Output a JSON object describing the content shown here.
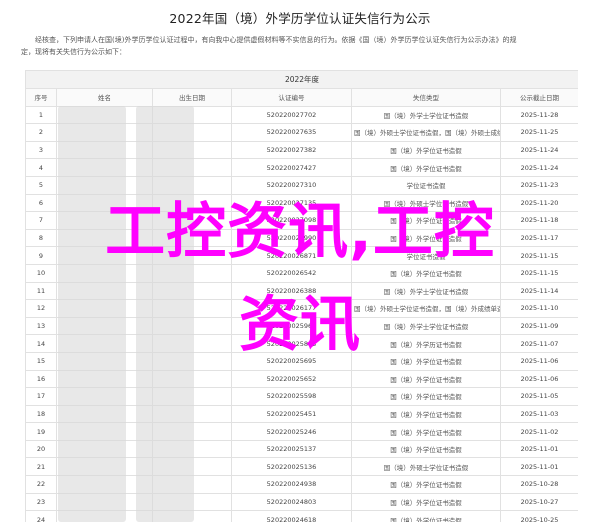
{
  "page_title": "2022年国（境）外学历学位认证失信行为公示",
  "intro_lines": [
    "经核查，下列申请人在国(境)外学历学位认证过程中，有向我中心提供虚假材料等不实信息的行为。依据《国（境）外学历学位认证失信行为公示办法》的规",
    "定，现将有关失信行为公示如下："
  ],
  "table": {
    "caption": "2022年度",
    "headers": [
      "序号",
      "姓名",
      "出生日期",
      "认证编号",
      "失信类型",
      "公示截止日期"
    ],
    "rows": [
      {
        "no": "1",
        "cert": "520220027702",
        "type": "国（境）外学士学位证书造假",
        "date": "2025-11-28"
      },
      {
        "no": "2",
        "cert": "520220027635",
        "type": "国（境）外硕士学位证书造假，国（境）外硕士成绩单造假",
        "date": "2025-11-25"
      },
      {
        "no": "3",
        "cert": "520220027382",
        "type": "国（境）外学位证书造假",
        "date": "2025-11-24"
      },
      {
        "no": "4",
        "cert": "520220027427",
        "type": "国（境）外学位证书造假",
        "date": "2025-11-24"
      },
      {
        "no": "5",
        "cert": "520220027310",
        "type": "学位证书造假",
        "date": "2025-11-23"
      },
      {
        "no": "6",
        "cert": "520220027135",
        "type": "国（境）外硕士学位证书造假",
        "date": "2025-11-20"
      },
      {
        "no": "7",
        "cert": "520220027098",
        "type": "国（境）外学位证书造假",
        "date": "2025-11-18"
      },
      {
        "no": "8",
        "cert": "520220026990",
        "type": "国（境）外学位证书造假",
        "date": "2025-11-17"
      },
      {
        "no": "9",
        "cert": "520220026871",
        "type": "学位证书造假",
        "date": "2025-11-15"
      },
      {
        "no": "10",
        "cert": "520220026542",
        "type": "国（境）外学位证书造假",
        "date": "2025-11-15"
      },
      {
        "no": "11",
        "cert": "520220026388",
        "type": "国（境）外学士学位证书造假",
        "date": "2025-11-14"
      },
      {
        "no": "12",
        "cert": "520220026177",
        "type": "国（境）外硕士学位证书造假，国（境）外成绩单造假",
        "date": "2025-11-10"
      },
      {
        "no": "13",
        "cert": "520220025964",
        "type": "国（境）外学士学位证书造假",
        "date": "2025-11-09"
      },
      {
        "no": "14",
        "cert": "520220025803",
        "type": "国（境）外学历证书造假",
        "date": "2025-11-07"
      },
      {
        "no": "15",
        "cert": "520220025695",
        "type": "国（境）外学位证书造假",
        "date": "2025-11-06"
      },
      {
        "no": "16",
        "cert": "520220025652",
        "type": "国（境）外学位证书造假",
        "date": "2025-11-06"
      },
      {
        "no": "17",
        "cert": "520220025598",
        "type": "国（境）外学位证书造假",
        "date": "2025-11-05"
      },
      {
        "no": "18",
        "cert": "520220025451",
        "type": "国（境）外学位证书造假",
        "date": "2025-11-03"
      },
      {
        "no": "19",
        "cert": "520220025246",
        "type": "国（境）外学位证书造假",
        "date": "2025-11-02"
      },
      {
        "no": "20",
        "cert": "520220025137",
        "type": "国（境）外学位证书造假",
        "date": "2025-11-01"
      },
      {
        "no": "21",
        "cert": "520220025136",
        "type": "国（境）外硕士学位证书造假",
        "date": "2025-11-01"
      },
      {
        "no": "22",
        "cert": "520220024938",
        "type": "国（境）外学位证书造假",
        "date": "2025-10-28"
      },
      {
        "no": "23",
        "cert": "520220024803",
        "type": "国（境）外学位证书造假",
        "date": "2025-10-27"
      },
      {
        "no": "24",
        "cert": "520220024618",
        "type": "国（境）外学位证书造假",
        "date": "2025-10-25"
      }
    ]
  },
  "watermark": {
    "line1": "工控资讯,工控",
    "line2": "资讯",
    "color": "#ff00ff"
  }
}
